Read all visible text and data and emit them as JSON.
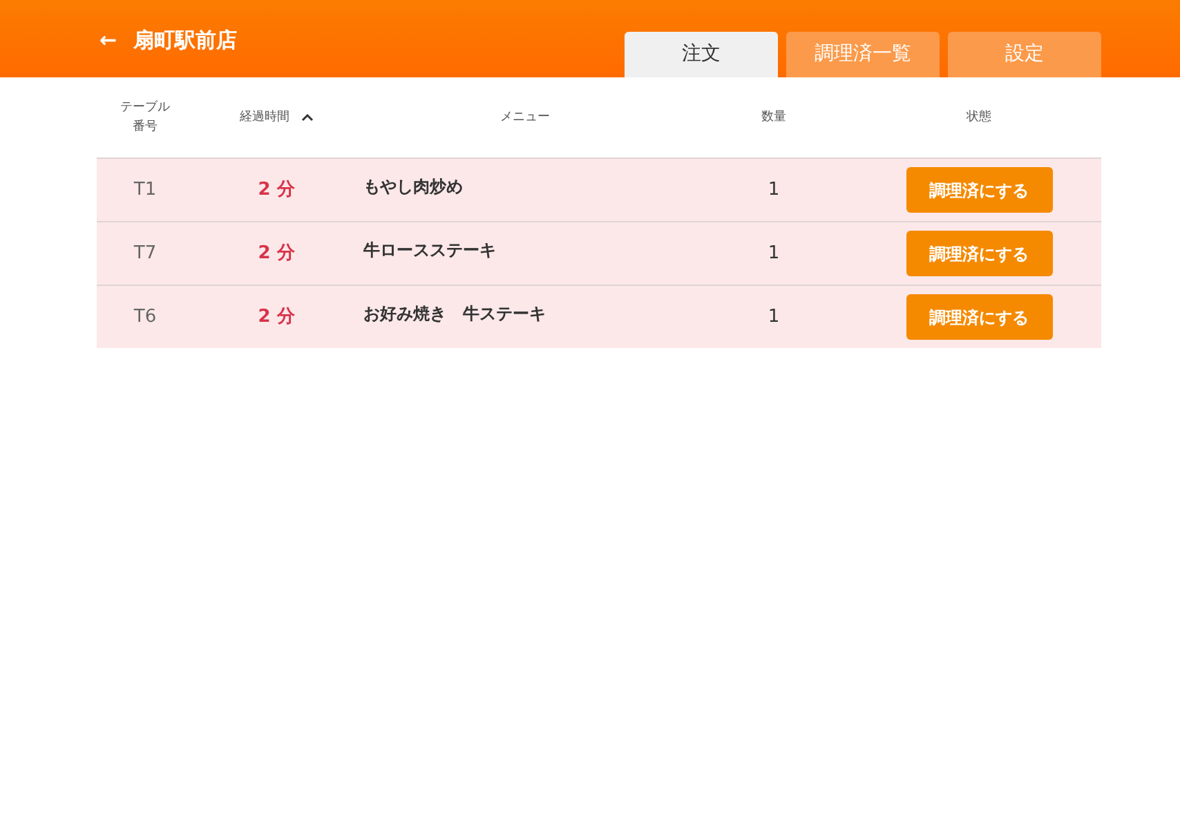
{
  "header": {
    "back": "←",
    "title": "扇町駅前店"
  },
  "tabs": [
    {
      "label": "注文",
      "selected": true
    },
    {
      "label": "調理済一覧",
      "selected": false
    },
    {
      "label": "設定",
      "selected": false
    }
  ],
  "table": {
    "columns": [
      {
        "label": "テーブル番号",
        "sorted": false
      },
      {
        "label": "経過時間",
        "sorted": true
      },
      {
        "label": "メニュー",
        "sorted": false
      },
      {
        "label": "数量",
        "sorted": false
      },
      {
        "label": "状態",
        "sorted": false
      }
    ],
    "rows": [
      {
        "table": "T1",
        "elapsed": "2 分",
        "menu": "もやし肉炒め",
        "quantity": "1",
        "action": "調理済にする"
      },
      {
        "table": "T7",
        "elapsed": "2 分",
        "menu": "牛ロースステーキ",
        "quantity": "1",
        "action": "調理済にする"
      },
      {
        "table": "T6",
        "elapsed": "2 分",
        "menu": "お好み焼き　牛ステーキ",
        "quantity": "1",
        "action": "調理済にする"
      }
    ]
  }
}
